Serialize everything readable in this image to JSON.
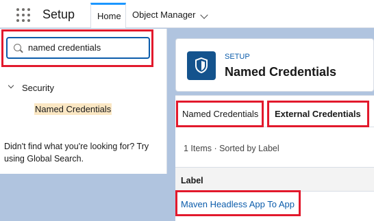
{
  "header": {
    "app_title": "Setup",
    "tabs": [
      {
        "label": "Home"
      },
      {
        "label": "Object Manager"
      }
    ]
  },
  "sidebar": {
    "search": {
      "value": "named credentials"
    },
    "tree": {
      "section": "Security",
      "item": "Named Credentials"
    },
    "help_text": "Didn't find what you're looking for? Try using Global Search."
  },
  "page": {
    "breadcrumb": "SETUP",
    "title": "Named Credentials",
    "tabs": [
      {
        "label": "Named Credentials"
      },
      {
        "label": "External Credentials"
      }
    ],
    "list_info": "1 Items · Sorted by Label",
    "table": {
      "columns": [
        "Label"
      ],
      "rows": [
        {
          "label": "Maven Headless App To App"
        }
      ]
    }
  },
  "icons": {
    "launcher": "app-launcher-icon",
    "search": "search-icon",
    "shield": "shield-icon"
  },
  "colors": {
    "brand": "#0b5cab",
    "highlight": "#e2192c",
    "background": "#b0c4df"
  }
}
